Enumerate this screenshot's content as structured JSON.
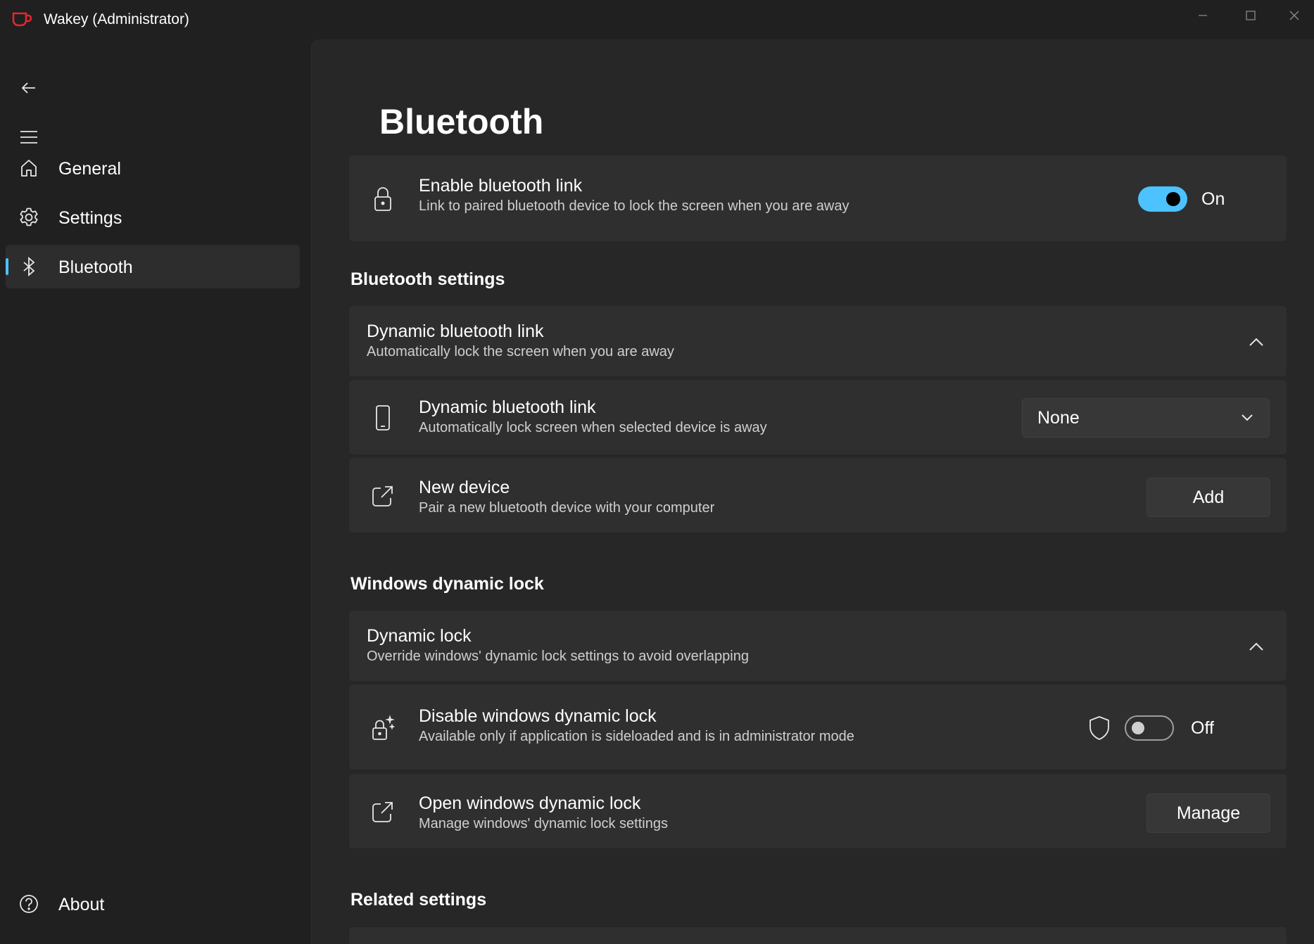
{
  "window": {
    "title": "Wakey (Administrator)",
    "accent_color": "#4cc2ff",
    "logo_color": "#e3262f"
  },
  "sidebar": {
    "back_icon": "back-arrow-icon",
    "menu_icon": "hamburger-menu-icon",
    "items": [
      {
        "label": "General",
        "icon": "home-icon",
        "selected": false
      },
      {
        "label": "Settings",
        "icon": "gear-icon",
        "selected": false
      },
      {
        "label": "Bluetooth",
        "icon": "bluetooth-icon",
        "selected": true
      }
    ],
    "footer_item": {
      "label": "About",
      "icon": "help-circle-icon"
    }
  },
  "page": {
    "title": "Bluetooth",
    "enable_card": {
      "title": "Enable bluetooth link",
      "description": "Link to paired bluetooth device to lock the screen when you are away",
      "toggle_state": "On",
      "toggle_on": true
    },
    "bluetooth_settings": {
      "header": "Bluetooth settings",
      "expander": {
        "title": "Dynamic bluetooth link",
        "description": "Automatically lock the screen when you are away",
        "expanded": true
      },
      "device_row": {
        "title": "Dynamic bluetooth link",
        "description": "Automatically lock screen when selected device is away",
        "selected_value": "None"
      },
      "new_device_row": {
        "title": "New device",
        "description": "Pair a new bluetooth device with your computer",
        "button_label": "Add"
      }
    },
    "windows_dynamic_lock": {
      "header": "Windows dynamic lock",
      "expander": {
        "title": "Dynamic lock",
        "description": "Override windows' dynamic lock settings to avoid overlapping",
        "expanded": true
      },
      "disable_row": {
        "title": "Disable windows dynamic lock",
        "description": "Available only if application is sideloaded and is in administrator mode",
        "toggle_state": "Off",
        "toggle_on": false
      },
      "open_row": {
        "title": "Open windows dynamic lock",
        "description": "Manage windows' dynamic lock settings",
        "button_label": "Manage"
      }
    },
    "related_settings": {
      "header": "Related settings"
    }
  }
}
